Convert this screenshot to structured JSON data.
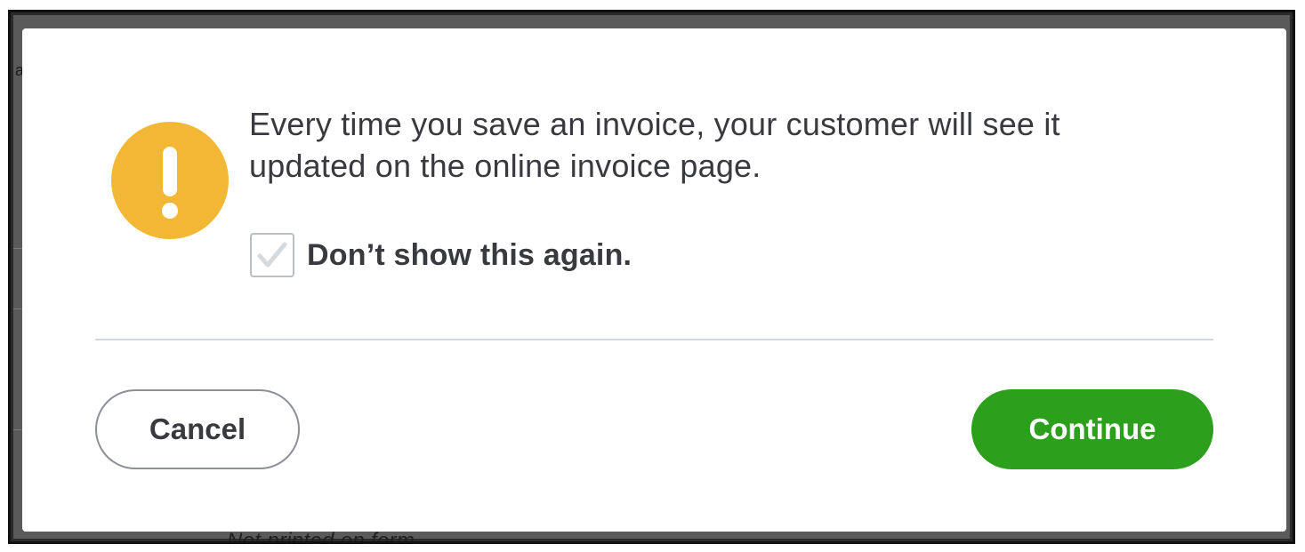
{
  "dialog": {
    "message": "Every time you save an invoice, your customer will see it updated on the online invoice page.",
    "checkbox_label": "Don’t show this again.",
    "checkbox_checked": true,
    "icon": "warning-exclamation-icon",
    "cancel_label": "Cancel",
    "continue_label": "Continue"
  },
  "background": {
    "partial_text": "Not printed on form",
    "left_fragment": "a"
  },
  "colors": {
    "warning": "#f2b835",
    "primary_button": "#2ca01c",
    "text": "#393a3d",
    "checkmark": "#d6d9de"
  }
}
